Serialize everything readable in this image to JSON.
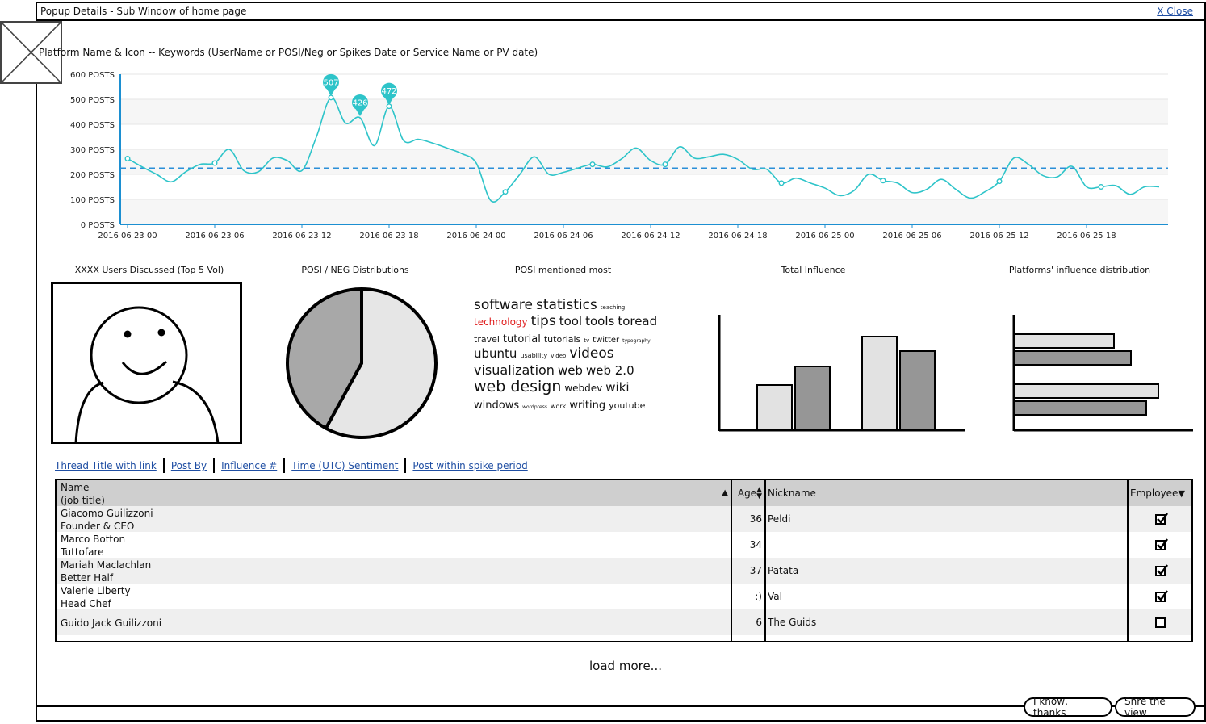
{
  "window": {
    "title": "Popup Details - Sub Window of home page",
    "close_label": "X Close"
  },
  "chart_header": "Platform Name & Icon -- Keywords (UserName or POSI/Neg or Spikes Date or Service Name or PV date)",
  "colors": {
    "line": "#2ec4c9",
    "axis": "#1c8fd1",
    "avg": "#2a8fd8",
    "link": "#1f4ea3",
    "hot_word": "#e01b1b"
  },
  "chart_data": [
    {
      "type": "line",
      "title": "",
      "ylabel": "",
      "ylim": [
        0,
        600
      ],
      "y_ticks": [
        "0 POSTS",
        "100 POSTS",
        "200 POSTS",
        "300 POSTS",
        "400 POSTS",
        "500 POSTS",
        "600 POSTS"
      ],
      "x_ticks": [
        "2016 06 23 00",
        "2016 06 23 06",
        "2016 06 23 12",
        "2016 06 23 18",
        "2016 06 24 00",
        "2016 06 24 06",
        "2016 06 24 12",
        "2016 06 24 18",
        "2016 06 25 00",
        "2016 06 25 06",
        "2016 06 25 12",
        "2016 06 25 18"
      ],
      "x_hours_per_tick": 6,
      "grid": "horizontal",
      "average": 225,
      "series": [
        {
          "values": [
            263,
            230,
            200,
            170,
            210,
            240,
            245,
            300,
            215,
            210,
            265,
            255,
            215,
            350,
            507,
            405,
            426,
            315,
            472,
            335,
            340,
            325,
            305,
            283,
            245,
            95,
            130,
            200,
            270,
            200,
            208,
            225,
            240,
            230,
            262,
            305,
            255,
            240,
            310,
            265,
            270,
            280,
            260,
            220,
            220,
            165,
            185,
            165,
            145,
            115,
            135,
            200,
            175,
            165,
            127,
            140,
            180,
            140,
            105,
            130,
            172,
            265,
            240,
            195,
            190,
            232,
            150,
            150,
            155,
            120,
            150,
            150
          ],
          "markers": [
            0,
            6,
            14,
            18,
            26,
            32,
            37,
            45,
            52,
            60,
            67
          ],
          "flags": [
            {
              "index": 14,
              "label": "507"
            },
            {
              "index": 16,
              "label": "426"
            },
            {
              "index": 18,
              "label": "472"
            }
          ]
        }
      ]
    },
    {
      "type": "pie",
      "title": "",
      "slices": [
        58,
        42
      ]
    },
    {
      "type": "bar",
      "title": "",
      "categories": [
        "",
        ""
      ],
      "series": [
        {
          "values": [
            55,
            115
          ]
        },
        {
          "values": [
            78,
            97
          ]
        }
      ]
    },
    {
      "type": "bar",
      "orientation": "horizontal",
      "title": "",
      "categories": [
        "",
        ""
      ],
      "series": [
        {
          "values": [
            123,
            178
          ]
        },
        {
          "values": [
            144,
            163
          ]
        }
      ]
    }
  ],
  "sections": {
    "users": "XXXX Users Discussed (Top 5 Vol)",
    "posneg": "POSI / NEG Distributions",
    "posi_most": "POSI mentioned most",
    "total_influence": "Total Influence",
    "platform_influence": "Platforms' influence distribution"
  },
  "word_cloud": [
    {
      "text": "software",
      "size": 17
    },
    {
      "text": "statistics",
      "size": 17
    },
    {
      "text": "teaching",
      "size": 7
    },
    {
      "text": "technology",
      "size": 12,
      "hot": true
    },
    {
      "text": "tips",
      "size": 17
    },
    {
      "text": "tool",
      "size": 15
    },
    {
      "text": "tools",
      "size": 15
    },
    {
      "text": "toread",
      "size": 15
    },
    {
      "text": "travel",
      "size": 11
    },
    {
      "text": "tutorial",
      "size": 13
    },
    {
      "text": "tutorials",
      "size": 11
    },
    {
      "text": "tv",
      "size": 7
    },
    {
      "text": "twitter",
      "size": 10
    },
    {
      "text": "typography",
      "size": 6
    },
    {
      "text": "ubuntu",
      "size": 15
    },
    {
      "text": "usability",
      "size": 8
    },
    {
      "text": "video",
      "size": 7
    },
    {
      "text": "videos",
      "size": 17
    },
    {
      "text": "visualization",
      "size": 16
    },
    {
      "text": "web",
      "size": 15
    },
    {
      "text": "web 2.0",
      "size": 15
    },
    {
      "text": "web design",
      "size": 19
    },
    {
      "text": "webdev",
      "size": 12
    },
    {
      "text": "wiki",
      "size": 15
    },
    {
      "text": "windows",
      "size": 13
    },
    {
      "text": "wordpress",
      "size": 6
    },
    {
      "text": "work",
      "size": 8
    },
    {
      "text": "writing",
      "size": 13
    },
    {
      "text": "youtube",
      "size": 11
    }
  ],
  "tabs": [
    {
      "label": "Thread Title with link"
    },
    {
      "label": "Post By"
    },
    {
      "label": "Influence #"
    },
    {
      "label": "Time (UTC) Sentiment"
    },
    {
      "label": "Post within spike period"
    }
  ],
  "table": {
    "headers": {
      "name": "Name",
      "job": "(job title)",
      "age": "Age",
      "nickname": "Nickname",
      "employee": "Employee"
    },
    "rows": [
      {
        "name": "Giacomo Guilizzoni",
        "job": "Founder & CEO",
        "age": "36",
        "nickname": "Peldi",
        "employee": true
      },
      {
        "name": "Marco Botton",
        "job": "Tuttofare",
        "age": "34",
        "nickname": "",
        "employee": true
      },
      {
        "name": "Mariah Maclachlan",
        "job": "Better Half",
        "age": "37",
        "nickname": "Patata",
        "employee": true
      },
      {
        "name": "Valerie Liberty",
        "job": "Head Chef",
        "age": ":)",
        "nickname": "Val",
        "employee": true
      },
      {
        "name": "Guido Jack Guilizzoni",
        "job": "",
        "age": "6",
        "nickname": "The Guids",
        "employee": false
      }
    ]
  },
  "load_more": "load more...",
  "buttons": {
    "thanks": "I know, thanks",
    "share": "Shre the view"
  }
}
